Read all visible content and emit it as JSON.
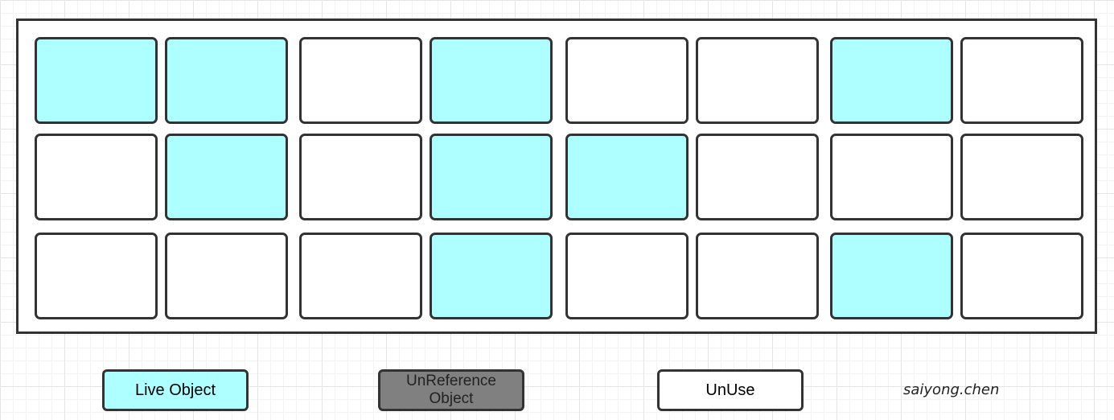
{
  "memory": {
    "rows": [
      [
        "live",
        "live",
        "unuse",
        "live",
        "unuse",
        "unuse",
        "live",
        "unuse"
      ],
      [
        "unuse",
        "live",
        "unuse",
        "live",
        "live",
        "unuse",
        "unuse",
        "unuse"
      ],
      [
        "unuse",
        "unuse",
        "unuse",
        "live",
        "unuse",
        "unuse",
        "live",
        "unuse"
      ]
    ]
  },
  "legend": {
    "live": "Live Object",
    "unref": "UnReference\nObject",
    "unuse": "UnUse"
  },
  "author": "saiyong.chen",
  "colors": {
    "live": "#aeffff",
    "unref": "#808080",
    "unuse": "#ffffff",
    "border": "#333333"
  }
}
